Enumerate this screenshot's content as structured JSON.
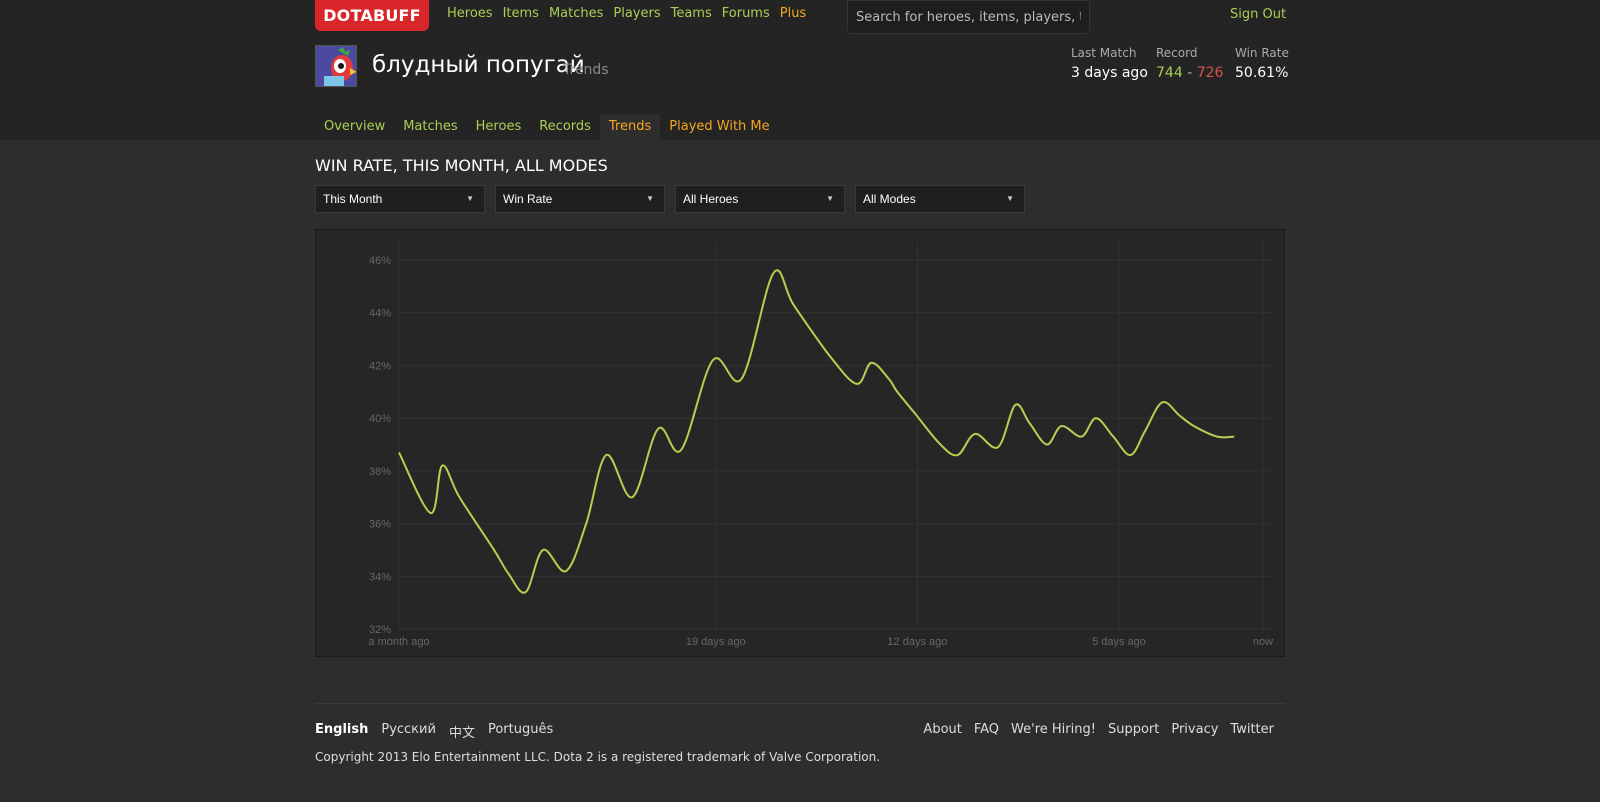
{
  "logo": "DOTABUFF",
  "nav": [
    "Heroes",
    "Items",
    "Matches",
    "Players",
    "Teams",
    "Forums",
    "Plus"
  ],
  "search": {
    "placeholder": "Search for heroes, items, players, teams"
  },
  "sign_out": "Sign Out",
  "player": {
    "name": "блудный попугай",
    "subtitle": "Trends"
  },
  "stats": {
    "last_match_label": "Last Match",
    "last_match_value": "3 days ago",
    "record_label": "Record",
    "wins": "744",
    "record_sep": "-",
    "losses": "726",
    "win_rate_label": "Win Rate",
    "win_rate_value": "50.61%"
  },
  "tabs": [
    "Overview",
    "Matches",
    "Heroes",
    "Records",
    "Trends",
    "Played With Me"
  ],
  "section_title": "WIN RATE, THIS MONTH, ALL MODES",
  "filters": [
    "This Month",
    "Win Rate",
    "All Heroes",
    "All Modes"
  ],
  "chart_data": {
    "type": "line",
    "x_tick_labels": [
      "a month ago",
      "19 days ago",
      "12 days ago",
      "5 days ago",
      "now"
    ],
    "y_tick_labels": [
      "46%",
      "44%",
      "42%",
      "40%",
      "38%",
      "36%",
      "34%",
      "32%"
    ],
    "ylim": [
      32,
      46
    ],
    "xlim": [
      30,
      0
    ],
    "x_unit": "days ago",
    "y_unit": "%",
    "grid": true,
    "line_color": "#b4d050",
    "series": [
      {
        "x": [
          30.0,
          28.9,
          28.5,
          27.9,
          26.7,
          26.2,
          25.6,
          25.0,
          24.2,
          23.5,
          22.8,
          21.9,
          21.0,
          20.2,
          19.1,
          18.1,
          17.0,
          16.3,
          15.0,
          14.1,
          13.6,
          13.0,
          12.7,
          12.1,
          11.2,
          10.6,
          10.0,
          9.2,
          8.6,
          8.1,
          7.5,
          7.0,
          6.3,
          5.8,
          5.2,
          4.6,
          4.1,
          3.5,
          2.9,
          2.4,
          1.6,
          1.0
        ],
        "y": [
          38.7,
          36.4,
          38.2,
          37.0,
          35.0,
          34.1,
          33.4,
          35.0,
          34.2,
          36.0,
          38.6,
          37.0,
          39.6,
          38.8,
          42.2,
          41.5,
          45.5,
          44.3,
          42.3,
          41.3,
          42.1,
          41.5,
          41.0,
          40.2,
          39.0,
          38.6,
          39.4,
          38.9,
          40.5,
          39.8,
          39.0,
          39.7,
          39.3,
          40.0,
          39.3,
          38.6,
          39.5,
          40.6,
          40.1,
          39.7,
          39.3,
          39.3
        ]
      }
    ]
  }
}
